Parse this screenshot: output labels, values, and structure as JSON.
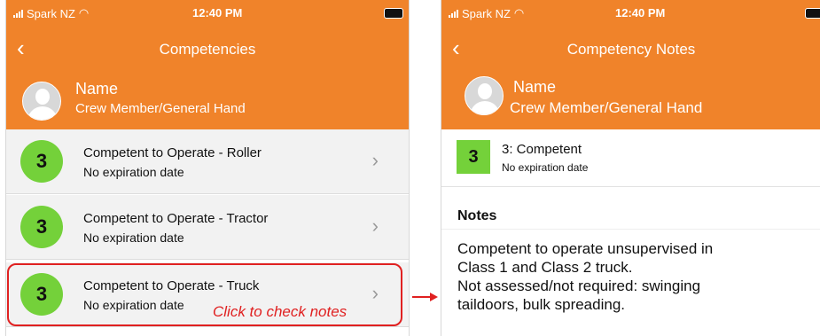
{
  "status_bar": {
    "carrier": "Spark NZ",
    "time": "12:40 PM"
  },
  "left_screen": {
    "back_icon": "chevron-left-icon",
    "title": "Competencies",
    "profile": {
      "name": "Name",
      "role": "Crew Member/General Hand"
    },
    "competencies": [
      {
        "level": "3",
        "title": "Competent to Operate - Roller",
        "expiry": "No expiration date"
      },
      {
        "level": "3",
        "title": "Competent to Operate - Tractor",
        "expiry": "No expiration date"
      },
      {
        "level": "3",
        "title": "Competent to Operate - Truck",
        "expiry": "No expiration date"
      }
    ]
  },
  "annotation": {
    "text": "Click to check notes",
    "color": "#e02020"
  },
  "right_screen": {
    "title": "Competency Notes",
    "profile": {
      "name": "Name",
      "role": "Crew Member/General Hand"
    },
    "competency": {
      "level": "3",
      "label": "3: Competent",
      "expiry": "No expiration date"
    },
    "notes_heading": "Notes",
    "notes_text": "Competent to operate unsupervised in\nClass 1 and Class 2 truck.\nNot assessed/not required: swinging\ntaildoors, bulk spreading."
  },
  "colors": {
    "brand_orange": "#f0832a",
    "level_green": "#74d13a"
  }
}
